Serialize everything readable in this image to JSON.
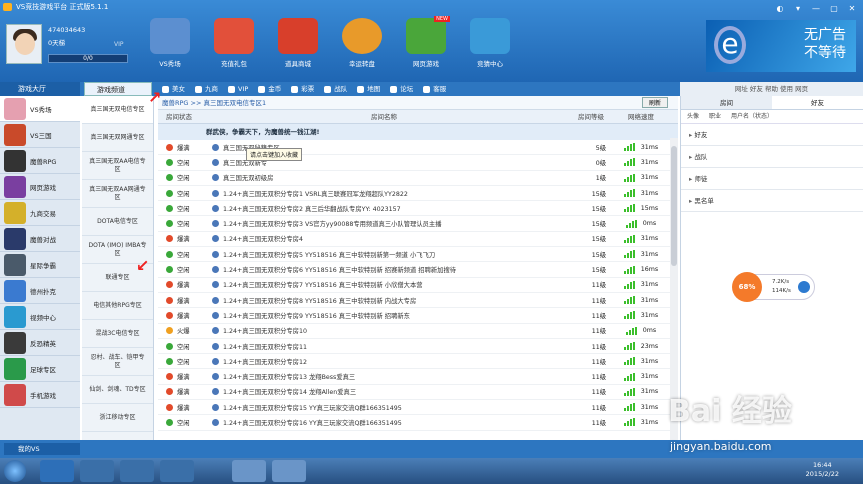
{
  "window": {
    "title": "VS竞技游戏平台  正式版5.1.1",
    "buttons": [
      "◐",
      "▾",
      "—",
      "▢",
      "✕"
    ]
  },
  "user": {
    "id": "474034643",
    "rank": "0天梯",
    "vip": "VIP",
    "progress": "0/0"
  },
  "topnav": [
    {
      "label": "VS秀场",
      "color": "#5c8fd0"
    },
    {
      "label": "充值礼包",
      "color": "#e2503a"
    },
    {
      "label": "道具商城",
      "color": "#d83f2b"
    },
    {
      "label": "幸运转盘",
      "color": "#e89a2a"
    },
    {
      "label": "网页游戏",
      "color": "#4aa63a",
      "badge": "NEW"
    },
    {
      "label": "竞猜中心",
      "color": "#3a9ad8"
    }
  ],
  "ad": {
    "line1": "无广告",
    "line2": "不等待",
    "glyph": "e"
  },
  "toolbar": {
    "hall": "游戏大厅",
    "game": "游戏频道",
    "items": [
      "美女",
      "九商",
      "VIP",
      "金币",
      "彩票",
      "战队",
      "地图",
      "论坛",
      "客服"
    ],
    "right": "网址  好友  帮助  使用  网页"
  },
  "leftbar": [
    {
      "label": "VS秀场",
      "color": "#e5a0b0"
    },
    {
      "label": "VS三国",
      "color": "#c94a2a"
    },
    {
      "label": "魔兽RPG",
      "color": "#333"
    },
    {
      "label": "网页游戏",
      "color": "#7a3fa0"
    },
    {
      "label": "九商交易",
      "color": "#d4b02a"
    },
    {
      "label": "魔兽对战",
      "color": "#2a3a6a"
    },
    {
      "label": "星际争霸",
      "color": "#4a5a6a"
    },
    {
      "label": "德州扑克",
      "color": "#3a7ad0"
    },
    {
      "label": "视频中心",
      "color": "#2a9ad0"
    },
    {
      "label": "反恐精英",
      "color": "#3a3a3a"
    },
    {
      "label": "足球专区",
      "color": "#2a9a4a"
    },
    {
      "label": "手机游戏",
      "color": "#d04a4a"
    }
  ],
  "subbar": [
    "真三国无双电信专区",
    "真三国无双网通专区",
    "真三国无双AA电信专区",
    "真三国无双AA网通专区",
    "DOTA电信专区",
    "DOTA (IMO) IMBA专区",
    "联通专区",
    "电信其他RPG专区",
    "混战3C电信专区",
    "忍村、战车、铠甲专区",
    "仙剑、剑魂、TD专区",
    "浙江移动专区"
  ],
  "main": {
    "crumb": "魔兽RPG >> 真三国无双电信专区1",
    "refresh": "刷新",
    "columns": [
      "房间状态",
      "房间名称",
      "房间等级",
      "网络速度"
    ],
    "notice": "群武侠，争霸天下，为魔兽统一钱江湖!",
    "tooltip": "请点击键加入收藏",
    "rows": [
      {
        "status": "爆满",
        "dot": "#e24a2a",
        "name": "真三国无双秘籍专区",
        "level": "5级",
        "speed": "31ms"
      },
      {
        "status": "空闲",
        "dot": "#3aa83a",
        "name": "真三国无双新专",
        "level": "0级",
        "speed": "31ms"
      },
      {
        "status": "空闲",
        "dot": "#3aa83a",
        "name": "真三国无双初级房",
        "level": "1级",
        "speed": "31ms"
      },
      {
        "status": "空闲",
        "dot": "#3aa83a",
        "name": "1.24+真三国无双积分专房1 VSRL真三联赛冠军龙翔超队YY2822",
        "level": "15级",
        "speed": "31ms"
      },
      {
        "status": "空闲",
        "dot": "#3aa83a",
        "name": "1.24+真三国无双积分专房2 真三后华翻战队专房YY: 4023157",
        "level": "15级",
        "speed": "15ms"
      },
      {
        "status": "空闲",
        "dot": "#3aa83a",
        "name": "1.24+真三国无双积分专房3 VS官方yy90088专用频道真三小队管理认员主播",
        "level": "15级",
        "speed": "0ms"
      },
      {
        "status": "爆满",
        "dot": "#e24a2a",
        "name": "1.24+真三国无双积分专房4",
        "level": "15级",
        "speed": "31ms"
      },
      {
        "status": "空闲",
        "dot": "#3aa83a",
        "name": "1.24+真三国无双积分专房5 YY518516 真三中软特别新第一频道 小飞飞刀",
        "level": "15级",
        "speed": "31ms"
      },
      {
        "status": "空闲",
        "dot": "#3aa83a",
        "name": "1.24+真三国无双积分专房6 YY518516 真三中软特别新 招赛新频道 招聘新加搜待",
        "level": "15级",
        "speed": "16ms"
      },
      {
        "status": "爆满",
        "dot": "#e24a2a",
        "name": "1.24+真三国无双积分专房7 YY518516 真三中软特别新 小欣僧大本营",
        "level": "11级",
        "speed": "31ms"
      },
      {
        "status": "爆满",
        "dot": "#e24a2a",
        "name": "1.24+真三国无双积分专房8 YY518516 真三中软特别新 内战大专房",
        "level": "11级",
        "speed": "31ms"
      },
      {
        "status": "爆满",
        "dot": "#e24a2a",
        "name": "1.24+真三国无双积分专房9 YY518516 真三中软特别新 招聘新东",
        "level": "11级",
        "speed": "31ms"
      },
      {
        "status": "火爆",
        "dot": "#f0a020",
        "name": "1.24+真三国无双积分专房10",
        "level": "11级",
        "speed": "0ms"
      },
      {
        "status": "空闲",
        "dot": "#3aa83a",
        "name": "1.24+真三国无双积分专房11",
        "level": "11级",
        "speed": "23ms"
      },
      {
        "status": "空闲",
        "dot": "#3aa83a",
        "name": "1.24+真三国无双积分专房12",
        "level": "11级",
        "speed": "31ms"
      },
      {
        "status": "爆满",
        "dot": "#e24a2a",
        "name": "1.24+真三国无双积分专房13 龙翔Bess爱真三",
        "level": "11级",
        "speed": "31ms"
      },
      {
        "status": "爆满",
        "dot": "#e24a2a",
        "name": "1.24+真三国无双积分专房14 龙翔Allen爱真三",
        "level": "11级",
        "speed": "31ms"
      },
      {
        "status": "爆满",
        "dot": "#e24a2a",
        "name": "1.24+真三国无双积分专房15 YY真三玩家交流Q群166351495",
        "level": "11级",
        "speed": "31ms"
      },
      {
        "status": "空闲",
        "dot": "#3aa83a",
        "name": "1.24+真三国无双积分专房16 YY真三玩家交流Q群166351495",
        "level": "11级",
        "speed": "31ms"
      }
    ]
  },
  "right": {
    "tabs": [
      "房间",
      "好友"
    ],
    "head": [
      "头像",
      "职业",
      "用户名（状态）"
    ],
    "sections": [
      "好友",
      "战队",
      "师徒",
      "黑名单"
    ]
  },
  "float": {
    "pct": "68%",
    "up": "7.2K/s",
    "down": "114K/s"
  },
  "statusbar": {
    "mine": "我的VS"
  },
  "taskbar": {
    "time": "16:44",
    "date": "2015/2/22"
  },
  "watermark": {
    "text": "Bai 经验",
    "url": "jingyan.baidu.com"
  }
}
